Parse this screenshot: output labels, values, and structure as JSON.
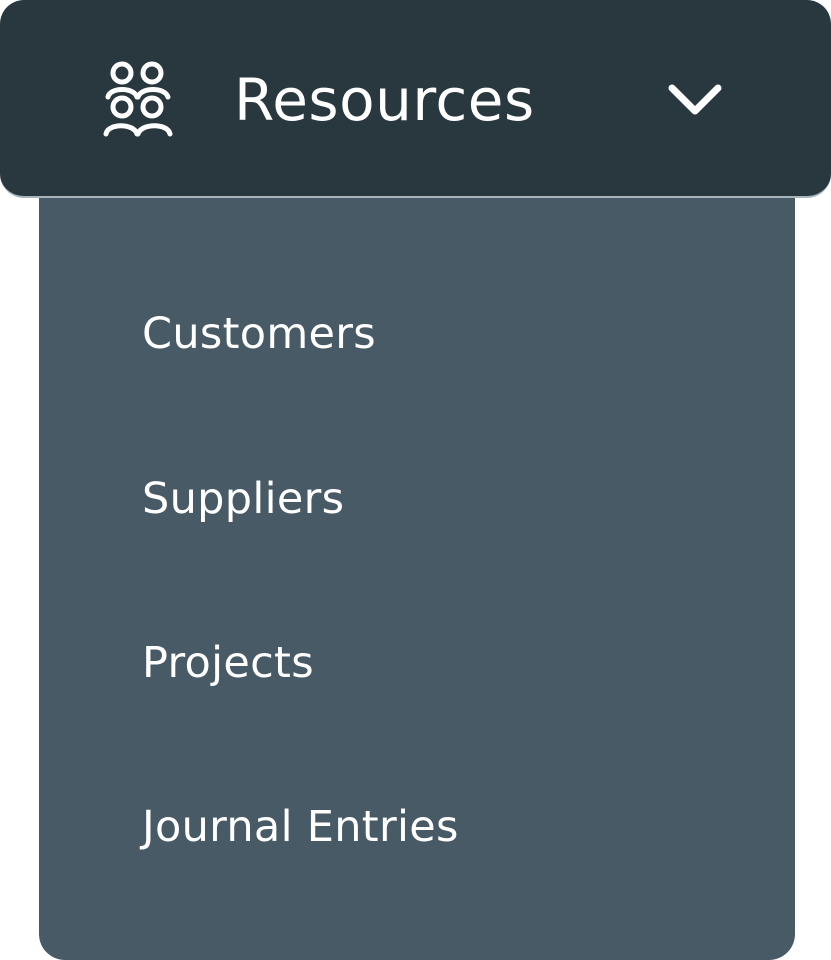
{
  "header": {
    "title": "Resources",
    "icon": "group-of-people-icon",
    "toggle_icon": "chevron-down-icon",
    "expanded": true
  },
  "menu": {
    "items": [
      {
        "label": "Customers"
      },
      {
        "label": "Suppliers"
      },
      {
        "label": "Projects"
      },
      {
        "label": "Journal Entries"
      }
    ]
  },
  "colors": {
    "header_bg": "#29373f",
    "panel_bg": "#485a66",
    "text": "#ffffff"
  }
}
